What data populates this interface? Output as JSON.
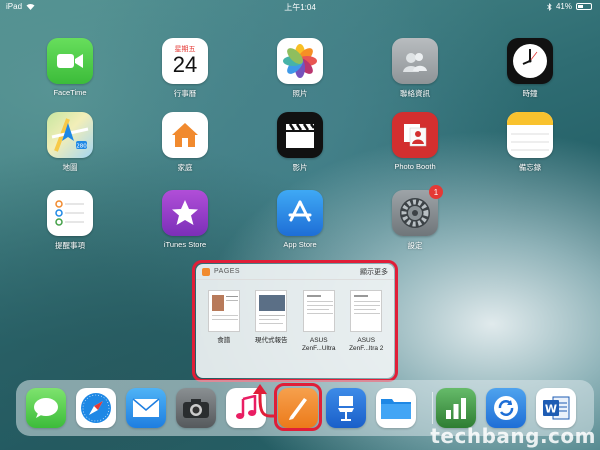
{
  "status": {
    "device": "iPad",
    "time": "上午1:04",
    "battery": "41%",
    "battery_level": 0.41
  },
  "apps": [
    {
      "id": "facetime",
      "label": "FaceTime",
      "icon": "video-camera-icon"
    },
    {
      "id": "calendar",
      "label": "行事曆",
      "icon": "calendar-icon",
      "weekday": "星期五",
      "day": "24"
    },
    {
      "id": "photos",
      "label": "照片",
      "icon": "photos-flower-icon"
    },
    {
      "id": "contacts",
      "label": "聯絡資訊",
      "icon": "contacts-icon"
    },
    {
      "id": "clock",
      "label": "時鐘",
      "icon": "clock-icon"
    },
    {
      "id": "maps",
      "label": "地圖",
      "icon": "map-icon",
      "route": "280"
    },
    {
      "id": "home",
      "label": "家庭",
      "icon": "house-icon"
    },
    {
      "id": "videos",
      "label": "影片",
      "icon": "clapperboard-icon"
    },
    {
      "id": "photobooth",
      "label": "Photo Booth",
      "icon": "photo-booth-icon"
    },
    {
      "id": "notes",
      "label": "備忘錄",
      "icon": "notes-icon"
    },
    {
      "id": "reminders",
      "label": "提醒事項",
      "icon": "reminders-list-icon"
    },
    {
      "id": "itunes",
      "label": "iTunes Store",
      "icon": "star-icon"
    },
    {
      "id": "appstore",
      "label": "App Store",
      "icon": "app-store-icon"
    },
    {
      "id": "settings",
      "label": "設定",
      "icon": "gear-icon",
      "badge": "1"
    }
  ],
  "popup": {
    "title": "PAGES",
    "show_more": "顯示更多",
    "documents": [
      {
        "label_line1": "食譜",
        "label_line2": ""
      },
      {
        "label_line1": "現代式報告",
        "label_line2": ""
      },
      {
        "label_line1": "ASUS",
        "label_line2": "ZenF...Ultra"
      },
      {
        "label_line1": "ASUS",
        "label_line2": "ZenF...ltra 2"
      }
    ]
  },
  "dock": [
    {
      "id": "messages",
      "icon": "speech-bubble-icon",
      "color": "#4cd964"
    },
    {
      "id": "safari",
      "icon": "compass-icon",
      "color": "#1e88e5"
    },
    {
      "id": "mail",
      "icon": "envelope-icon",
      "color": "#2196f3"
    },
    {
      "id": "camera",
      "icon": "camera-icon",
      "color": "#616161"
    },
    {
      "id": "music",
      "icon": "music-note-icon",
      "color": "#ffffff"
    },
    {
      "id": "pages",
      "icon": "pen-icon",
      "color": "#f18a2e"
    },
    {
      "id": "keynote",
      "icon": "podium-icon",
      "color": "#1976d2"
    },
    {
      "id": "files",
      "icon": "folder-icon",
      "color": "#1e88e5"
    },
    {
      "id": "numbers",
      "icon": "bar-chart-icon",
      "color": "#43a047"
    },
    {
      "id": "recent1",
      "icon": "sync-icon",
      "color": "#1e88e5"
    },
    {
      "id": "word",
      "icon": "word-icon",
      "color": "#1e5cb3",
      "letter": "W"
    }
  ],
  "watermark": {
    "text": "techbang.com"
  }
}
